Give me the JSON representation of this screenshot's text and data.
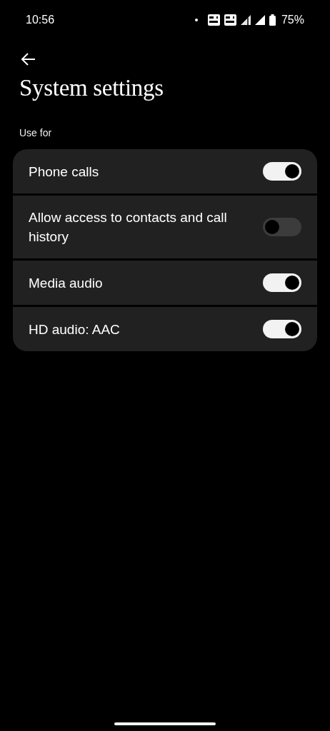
{
  "status_bar": {
    "time": "10:56",
    "battery": "75%"
  },
  "title": "System settings",
  "section": "Use for",
  "settings": [
    {
      "label": "Phone calls",
      "on": true
    },
    {
      "label": "Allow access to contacts and call history",
      "on": false
    },
    {
      "label": "Media audio",
      "on": true
    },
    {
      "label": "HD audio: AAC",
      "on": true
    }
  ]
}
